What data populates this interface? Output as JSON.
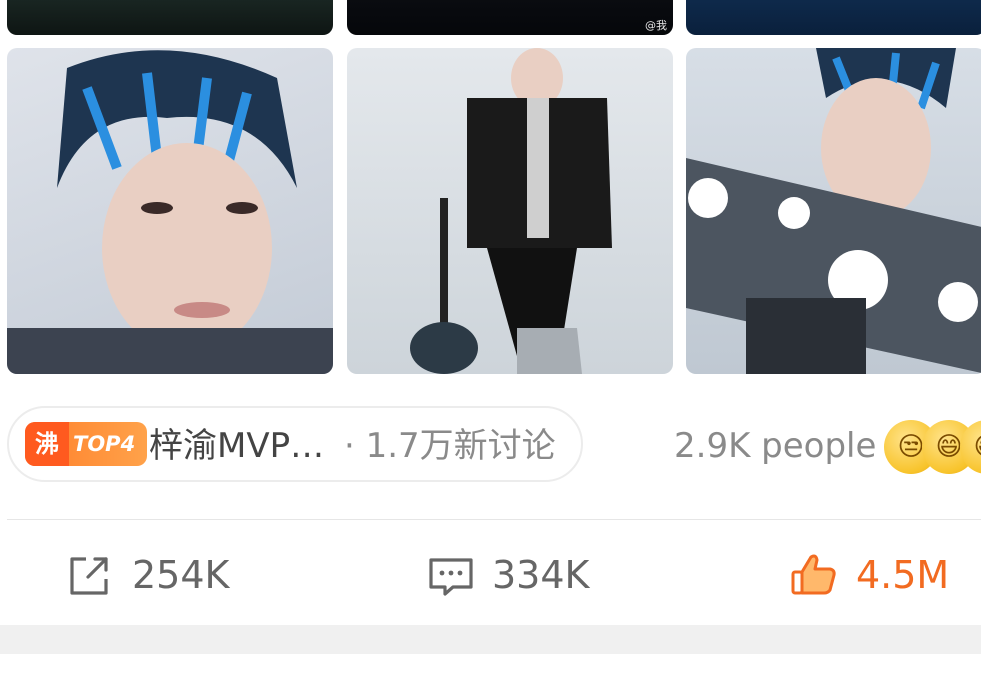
{
  "top_row_watermark": "@我",
  "hot_topic": {
    "badge_char": "沸",
    "badge_rank": "TOP4",
    "title": "梓渝MVP…",
    "meta": "· 1.7万新讨论"
  },
  "reactions": {
    "people_text": "2.9K people",
    "emojis": [
      "😒",
      "😄",
      "😄"
    ]
  },
  "actions": {
    "share_count": "254K",
    "comment_count": "334K",
    "like_count": "4.5M"
  },
  "colors": {
    "badge_orange": "#ff7f2a",
    "like_orange": "#f26b21",
    "icon_gray": "#666666"
  }
}
